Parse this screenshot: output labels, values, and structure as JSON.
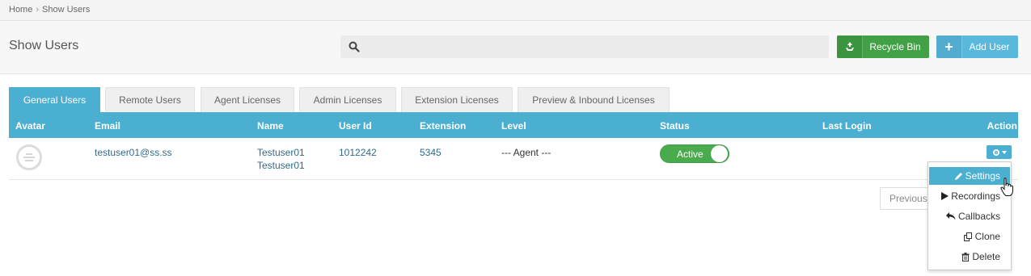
{
  "breadcrumb": {
    "home": "Home",
    "sep": "›",
    "current": "Show Users"
  },
  "page": {
    "title": "Show Users"
  },
  "search": {
    "placeholder": "",
    "value": ""
  },
  "buttons": {
    "recycle_bin": "Recycle Bin",
    "add_user": "Add User"
  },
  "tabs": [
    {
      "label": "General Users",
      "active": true
    },
    {
      "label": "Remote Users"
    },
    {
      "label": "Agent Licenses"
    },
    {
      "label": "Admin Licenses"
    },
    {
      "label": "Extension Licenses"
    },
    {
      "label": "Preview & Inbound Licenses"
    }
  ],
  "table": {
    "headers": {
      "avatar": "Avatar",
      "email": "Email",
      "name": "Name",
      "user_id": "User Id",
      "extension": "Extension",
      "level": "Level",
      "status": "Status",
      "last_login": "Last Login",
      "action": "Action"
    },
    "rows": [
      {
        "email": "testuser01@ss.ss",
        "name_first": "Testuser01",
        "name_last": "Testuser01",
        "user_id": "1012242",
        "extension": "5345",
        "level": "--- Agent ---",
        "status": "Active",
        "last_login": ""
      }
    ]
  },
  "pagination": {
    "previous": "Previous"
  },
  "action_menu": {
    "items": [
      "Settings",
      "Recordings",
      "Callbacks",
      "Clone",
      "Delete"
    ]
  },
  "colors": {
    "accent": "#4bafd1",
    "success": "#42a046",
    "info": "#5bb8dd"
  }
}
